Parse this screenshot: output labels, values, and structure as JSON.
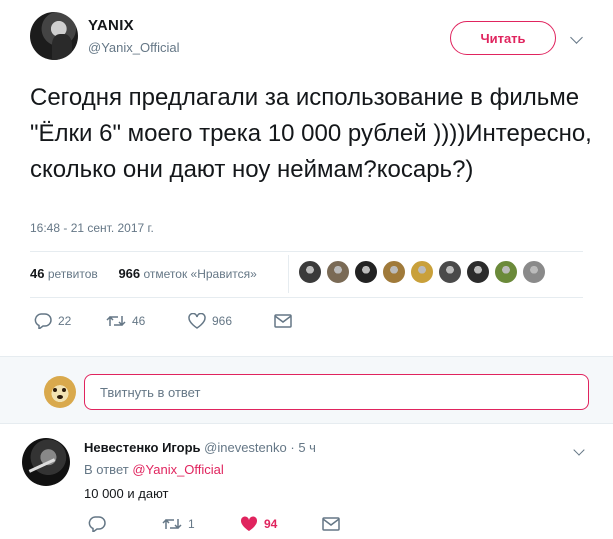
{
  "header": {
    "name": "YANIX",
    "handle": "@Yanix_Official",
    "follow_label": "Читать"
  },
  "tweet": {
    "text": "Сегодня предлагали за использование в фильме \"Ёлки 6\" моего трека 10 000 рублей ))))Интересно, сколько они дают ноу неймам?косарь?)",
    "timestamp": "16:48 - 21 сент. 2017 г.",
    "retweets_count": "46",
    "retweets_label": "ретвитов",
    "likes_count": "966",
    "likes_label": "отметок «Нравится»",
    "actions": {
      "replies": "22",
      "retweets": "46",
      "likes": "966"
    }
  },
  "likers": [
    "#3a3a3a",
    "#7a6a55",
    "#222222",
    "#a07a3a",
    "#c9a03a",
    "#4a4a4a",
    "#2b2b2b",
    "#6b8a3a",
    "#8a8a8a"
  ],
  "reply_box": {
    "placeholder": "Твитнуть в ответ"
  },
  "reply": {
    "name": "Невестенко Игорь",
    "handle": "@inevestenko",
    "time": "5 ч",
    "in_reply_prefix": "В ответ",
    "in_reply_to": "@Yanix_Official",
    "text": "10 000 и дают",
    "actions": {
      "replies": "",
      "retweets": "1",
      "likes": "94"
    }
  },
  "colors": {
    "accent": "#e0245e",
    "muted": "#657786",
    "text": "#14171a"
  }
}
